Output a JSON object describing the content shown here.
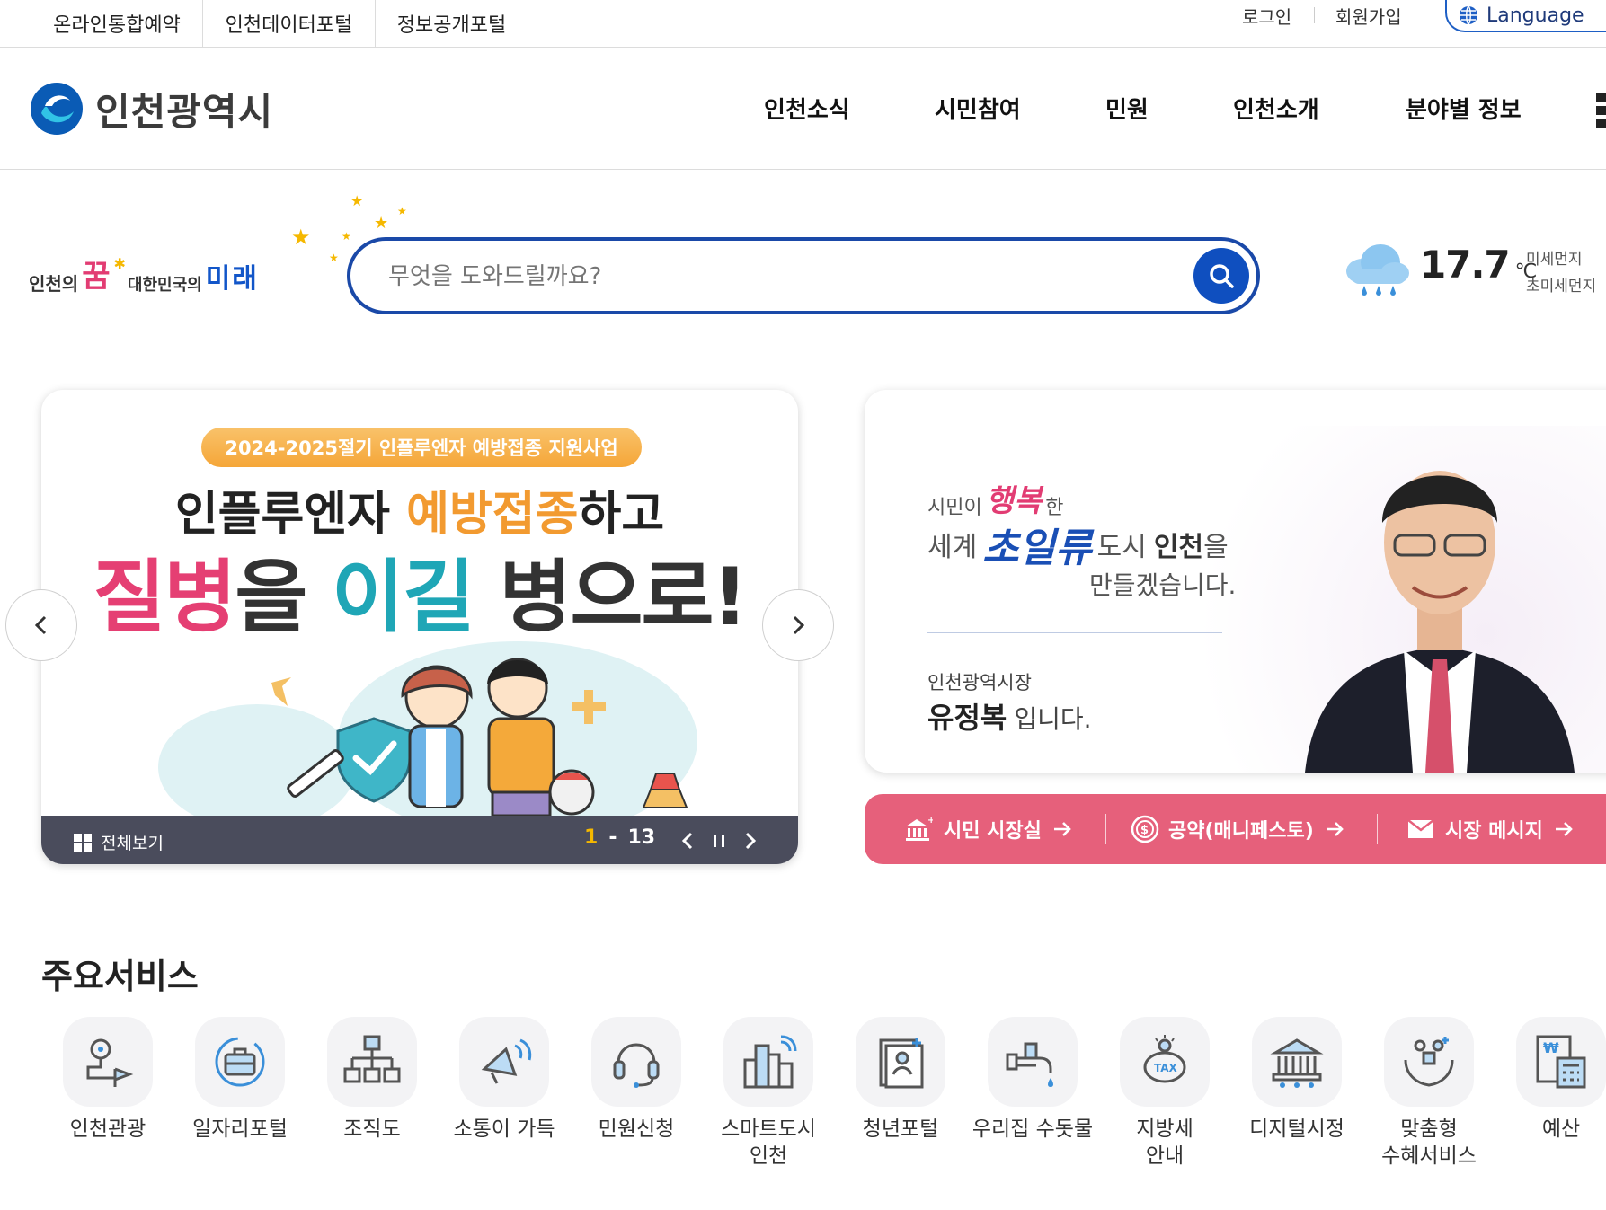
{
  "utility_links": [
    "온라인통합예약",
    "인천데이터포털",
    "정보공개포털"
  ],
  "account": {
    "login": "로그인",
    "signup": "회원가입",
    "language": "Language"
  },
  "site_name": "인천광역시",
  "gnb": [
    "인천소식",
    "시민참여",
    "민원",
    "인천소개",
    "분야별 정보"
  ],
  "slogan": {
    "part1": "인천의",
    "dream": "꿈",
    "part2": "대한민국의",
    "future": "미래"
  },
  "search": {
    "placeholder": "무엇을 도와드릴까요?"
  },
  "weather": {
    "temp": "17.7",
    "unit": "℃",
    "dust_label": "미세먼지",
    "fine_dust_label": "초미세먼지"
  },
  "banner": {
    "pill": "2024-2025절기 인플루엔자 예방접종 지원사업",
    "line1_a": "인플루엔자 ",
    "line1_hl": "예방접종",
    "line1_b": "하고",
    "line2_a": "질병",
    "line2_b": "을 ",
    "line2_c": "이길",
    "line2_d": " 병으로!",
    "view_all": "전체보기",
    "page_current": "1",
    "page_dash": "-",
    "page_total": "13"
  },
  "mayor": {
    "slogan_a": "시민이",
    "slogan_happy": "행복",
    "slogan_b": "한",
    "slogan_c": "세계",
    "slogan_top": "초일류",
    "slogan_d": "도시",
    "slogan_city": "인천",
    "slogan_e": "을",
    "slogan_f": "만들겠습니다.",
    "title": "인천광역시장",
    "name": "유정복",
    "name_suffix": "입니다."
  },
  "mayor_links": [
    "시민 시장실",
    "공약(매니페스토)",
    "시장 메시지"
  ],
  "colors": {
    "brand_blue": "#1a49a8",
    "pink": "#e6607b",
    "banner_bar": "#4a4c5c"
  },
  "services_title": "주요서비스",
  "services": [
    {
      "label": "인천관광",
      "icon": "map-pin-flag-icon"
    },
    {
      "label": "일자리포털",
      "icon": "briefcase-icon"
    },
    {
      "label": "조직도",
      "icon": "org-chart-icon"
    },
    {
      "label": "소통이 가득",
      "icon": "megaphone-icon"
    },
    {
      "label": "민원신청",
      "icon": "headset-icon"
    },
    {
      "label": "스마트도시\n인천",
      "icon": "smart-city-icon"
    },
    {
      "label": "청년포털",
      "icon": "youth-document-icon"
    },
    {
      "label": "우리집 수돗물",
      "icon": "faucet-icon"
    },
    {
      "label": "지방세\n안내",
      "icon": "tax-piggy-icon"
    },
    {
      "label": "디지털시정",
      "icon": "government-building-icon"
    },
    {
      "label": "맞춤형\n수혜서비스",
      "icon": "care-hands-icon"
    },
    {
      "label": "예산",
      "icon": "budget-calculator-icon"
    }
  ]
}
